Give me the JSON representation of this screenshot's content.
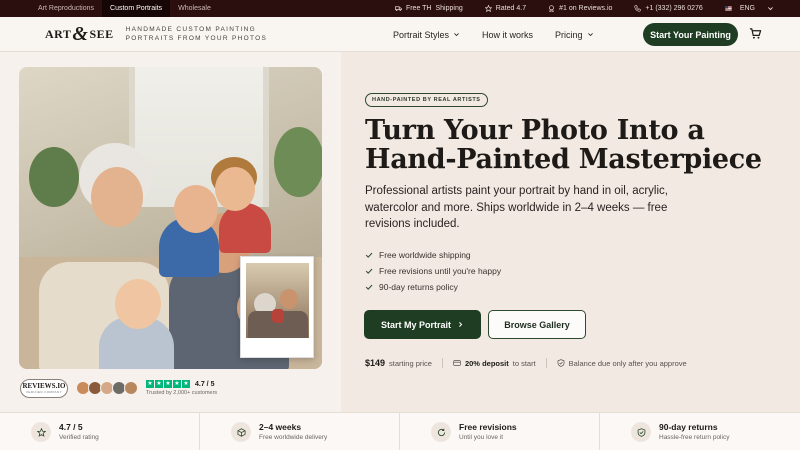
{
  "topbar": {
    "nav": [
      "Art Reproductions",
      "Custom Portraits",
      "Wholesale"
    ],
    "shipping": "Free TH",
    "shipping_label": "Shipping",
    "rating": "Rated 4.7",
    "reviews": "#1 on Reviews.io",
    "phone": "+1 (332) 296 0276",
    "language": "ENG"
  },
  "header": {
    "logo_left": "ART",
    "logo_amp": "&",
    "logo_right": "SEE",
    "tagline_1": "HANDMADE CUSTOM PAINTING",
    "tagline_2": "PORTRAITS FROM YOUR PHOTOS",
    "nav": [
      "Portrait Styles",
      "How it works",
      "Pricing"
    ],
    "cta": "Start Your Painting"
  },
  "hero": {
    "badge": "HAND-PAINTED BY REAL ARTISTS",
    "headline_1": "Turn Your Photo Into a",
    "headline_2": "Hand-Painted Masterpiece",
    "subtitle": "Professional artists paint your portrait by hand in oil, acrylic, watercolor and more. Ships worldwide in 2–4 weeks — free revisions included.",
    "bullets": [
      "Free worldwide shipping",
      "Free revisions until you're happy",
      "90-day returns policy"
    ],
    "primary_button": "Start My Portrait",
    "secondary_button": "Browse Gallery",
    "price": "$149",
    "price_label": "starting price",
    "deposit": "20% deposit",
    "deposit_label": "to start",
    "balance": "Balance due only after you approve"
  },
  "trust": {
    "badge_title": "REVIEWS.IO",
    "badge_sub": "VERIFIED COMPANY",
    "rating": "4.7 / 5",
    "trusted": "Trusted by 2,000+ customers"
  },
  "features": [
    {
      "title": "4.7 / 5",
      "subtitle": "Verified rating",
      "icon": "star-icon"
    },
    {
      "title": "2–4 weeks",
      "subtitle": "Free worldwide delivery",
      "icon": "globe-icon"
    },
    {
      "title": "Free revisions",
      "subtitle": "Until you love it",
      "icon": "refresh-icon"
    },
    {
      "title": "90-day returns",
      "subtitle": "Hassle-free return policy",
      "icon": "shield-icon"
    }
  ],
  "colors": {
    "topbar": "#2b0f0f",
    "accent_green": "#1f3d23",
    "panel": "#f1e9e2",
    "star_green": "#00b67a"
  }
}
